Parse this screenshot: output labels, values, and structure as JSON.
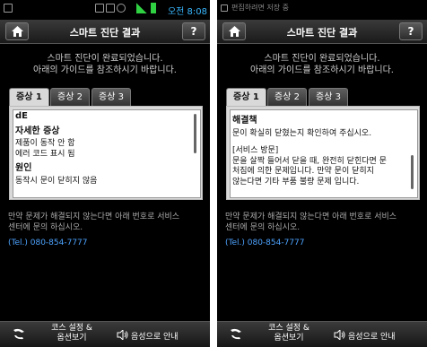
{
  "left": {
    "status": {
      "time": "오전 8:08",
      "status_text": ""
    },
    "header": {
      "title": "스마트 진단 결과",
      "help_label": "?"
    },
    "intro": {
      "line1": "스마트 진단이 완료되었습니다.",
      "line2": "아래의 가이드를 참조하시기 바랍니다."
    },
    "tabs": [
      "증상 1",
      "증상 2",
      "증상 3"
    ],
    "panel": {
      "code": "dE",
      "detail_title": "자세한 증상",
      "detail_lines": [
        "제품이 동작 안 함",
        "에러 코드 표시 됨"
      ],
      "cause_title": "원인",
      "cause_lines": [
        "동작시 문이 닫히지 않음"
      ]
    },
    "footer": {
      "line1": "만약 문제가 해결되지 않는다면 아래 번호로 서비스",
      "line2": "센터에 문의 하십시오.",
      "phone": "(Tel.) 080-854-7777"
    },
    "bottom": {
      "course_line1": "코스 설정 &",
      "course_line2": "옵션보기",
      "voice": "음성으로 안내"
    }
  },
  "right": {
    "status": {
      "time": "",
      "status_text": "편집하려면 저장 중"
    },
    "header": {
      "title": "스마트 진단 결과",
      "help_label": "?"
    },
    "intro": {
      "line1": "스마트 진단이 완료되었습니다.",
      "line2": "아래의 가이드를 참조하시기 바랍니다."
    },
    "tabs": [
      "증상 1",
      "증상 2",
      "증상 3"
    ],
    "panel": {
      "solution_title": "해결책",
      "solution_lines": [
        "문이 확실히 닫혔는지 확인하여 주십시오."
      ],
      "service_lines": [
        "[서비스 방문]",
        "문을 살짝 들어서 닫을 때, 완전히 닫힌다면 문",
        "처짐에 의한 문제입니다. 만약 문이 닫히지",
        "않는다면 기타 부품 불량 문제 입니다."
      ]
    },
    "footer": {
      "line1": "만약 문제가 해결되지 않는다면 아래 번호로 서비스",
      "line2": "센터에 문의 하십시오.",
      "phone": "(Tel.) 080-854-7777"
    },
    "bottom": {
      "course_line1": "코스 설정 &",
      "course_line2": "옵션보기",
      "voice": "음성으로 안내"
    }
  },
  "colors": {
    "accent_blue": "#39b8ff",
    "phone_link": "#4da3ff",
    "status_green": "#2fd142"
  },
  "icons": {
    "home": "home-icon",
    "help": "question-icon",
    "course": "washer-settings-icon",
    "voice": "speaker-icon"
  }
}
